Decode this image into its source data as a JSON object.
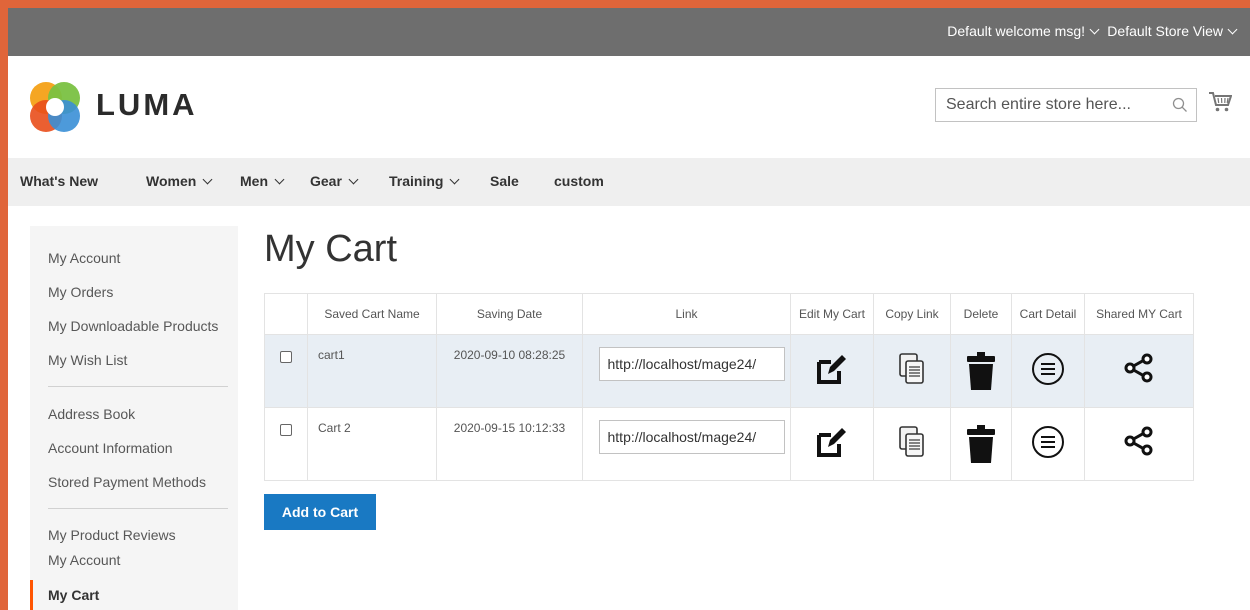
{
  "topbar": {
    "welcome": "Default welcome msg!",
    "store_view": "Default Store View"
  },
  "header": {
    "logo_text": "LUMA",
    "search_placeholder": "Search entire store here..."
  },
  "nav": [
    {
      "label": "What's New",
      "has_menu": false
    },
    {
      "label": "Women",
      "has_menu": true
    },
    {
      "label": "Men",
      "has_menu": true
    },
    {
      "label": "Gear",
      "has_menu": true
    },
    {
      "label": "Training",
      "has_menu": true
    },
    {
      "label": "Sale",
      "has_menu": false
    },
    {
      "label": "custom",
      "has_menu": false
    }
  ],
  "sidebar": {
    "items": [
      "My Account",
      "My Orders",
      "My Downloadable Products",
      "My Wish List",
      "Address Book",
      "Account Information",
      "Stored Payment Methods",
      "My Product Reviews",
      "My Account",
      "My Cart"
    ],
    "active": "My Cart"
  },
  "main": {
    "title": "My Cart",
    "table": {
      "headers": [
        "",
        "Saved Cart Name",
        "Saving Date",
        "Link",
        "Edit My Cart",
        "Copy Link",
        "Delete",
        "Cart Detail",
        "Shared MY Cart"
      ],
      "rows": [
        {
          "name": "cart1",
          "date": "2020-09-10 08:28:25",
          "link": "http://localhost/mage24/"
        },
        {
          "name": "Cart 2",
          "date": "2020-09-15 10:12:33",
          "link": "http://localhost/mage24/"
        }
      ]
    },
    "add_button": "Add to Cart"
  },
  "colors": {
    "frame": "#e0653a",
    "topbar": "#6e6e6e",
    "nav": "#efefef",
    "sidebar": "#f5f5f5",
    "active_marker": "#ff5501",
    "primary_button": "#1979c3",
    "row_highlight": "#e8eef4"
  },
  "icons": {
    "edit": "edit-icon",
    "copy": "copy-link-icon",
    "delete": "trash-icon",
    "detail": "list-circle-icon",
    "share": "share-icon",
    "search": "search-icon",
    "cart": "cart-icon"
  }
}
